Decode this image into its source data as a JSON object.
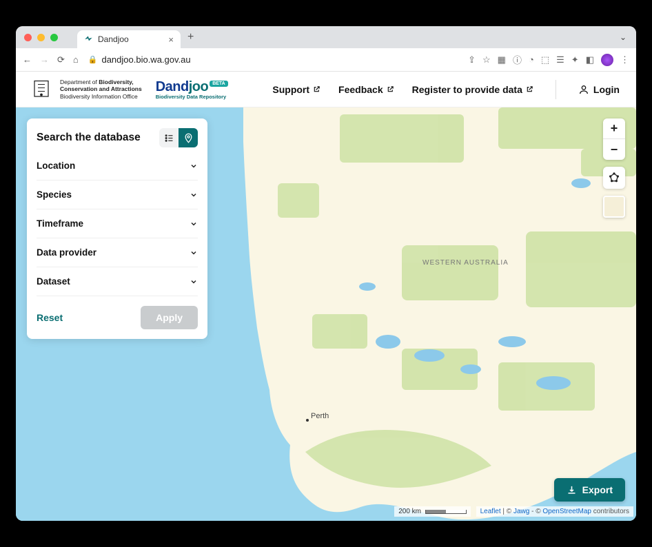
{
  "browser": {
    "tab_title": "Dandjoo",
    "url": "dandjoo.bio.wa.gov.au"
  },
  "header": {
    "department_line1": "Department of",
    "department_line1b": "Biodiversity,",
    "department_line2": "Conservation and Attractions",
    "department_line3": "Biodiversity Information Office",
    "brand_name": "Dandjoo",
    "brand_badge": "BETA",
    "brand_subtitle": "Biodiversity Data Repository",
    "nav": {
      "support": "Support",
      "feedback": "Feedback",
      "register": "Register to provide data"
    },
    "login": "Login"
  },
  "panel": {
    "title": "Search the database",
    "filters": {
      "location": "Location",
      "species": "Species",
      "timeframe": "Timeframe",
      "data_provider": "Data provider",
      "dataset": "Dataset"
    },
    "reset": "Reset",
    "apply": "Apply"
  },
  "map": {
    "region_label": "WESTERN AUSTRALIA",
    "city_label": "Perth",
    "scale_label": "200 km",
    "attribution_leaflet": "Leaflet",
    "attribution_sep1": " | © ",
    "attribution_jawg": "Jawg",
    "attribution_sep2": " - © ",
    "attribution_osm": "OpenStreetMap",
    "attribution_tail": " contributors",
    "export": "Export"
  },
  "colors": {
    "accent": "#0a6e72"
  }
}
